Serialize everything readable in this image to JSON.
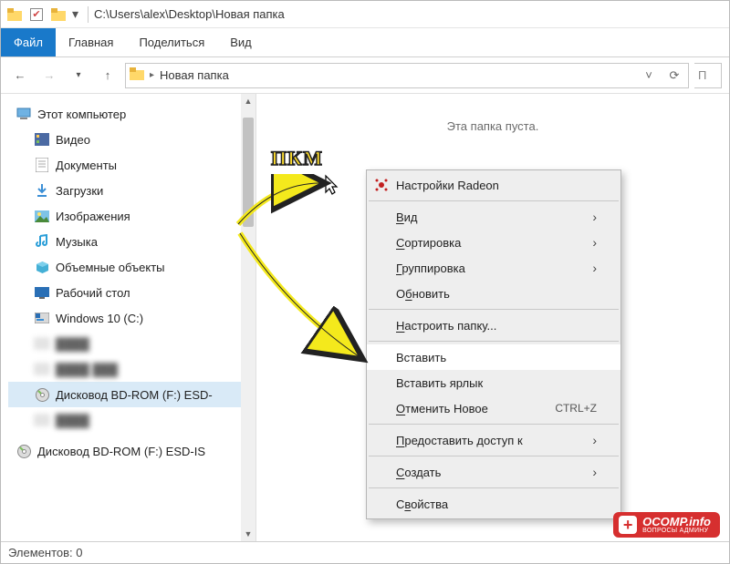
{
  "titlebar": {
    "path": "C:\\Users\\alex\\Desktop\\Новая папка"
  },
  "ribbon": {
    "file": "Файл",
    "home": "Главная",
    "share": "Поделиться",
    "view": "Вид"
  },
  "address": {
    "crumb": "Новая папка"
  },
  "search": {
    "placeholder": "П"
  },
  "sidebar": {
    "root": "Этот компьютер",
    "items": [
      {
        "label": "Видео"
      },
      {
        "label": "Документы"
      },
      {
        "label": "Загрузки"
      },
      {
        "label": "Изображения"
      },
      {
        "label": "Музыка"
      },
      {
        "label": "Объемные объекты"
      },
      {
        "label": "Рабочий стол"
      },
      {
        "label": "Windows 10 (C:)"
      },
      {
        "label": "blurred-1",
        "blur": true
      },
      {
        "label": "blurred-2",
        "blur": true
      },
      {
        "label": "Дисковод BD-ROM (F:) ESD-",
        "sel": true
      },
      {
        "label": "blurred-3",
        "blur": true
      }
    ],
    "root2": "Дисковод BD-ROM (F:) ESD-IS"
  },
  "content": {
    "empty": "Эта папка пуста."
  },
  "ctx": {
    "radeon": "Настройки Radeon",
    "view": "Вид",
    "sort": "Сортировка",
    "group": "Группировка",
    "refresh": "Обновить",
    "customize": "Настроить папку...",
    "paste": "Вставить",
    "paste_shortcut": "Вставить ярлык",
    "undo": "Отменить Новое",
    "undo_sc": "CTRL+Z",
    "share": "Предоставить доступ к",
    "new": "Создать",
    "properties": "Свойства",
    "underline": {
      "view": "В",
      "sort": "С",
      "group": "Г",
      "refresh": "б",
      "customize": "Н",
      "undo": "О",
      "share": "П",
      "new": "С",
      "properties": "в"
    }
  },
  "annotation": {
    "label": "ПКМ"
  },
  "status": {
    "text": "Элементов: 0"
  },
  "watermark": {
    "main": "OCOMP.info",
    "sub": "ВОПРОСЫ АДМИНУ"
  }
}
